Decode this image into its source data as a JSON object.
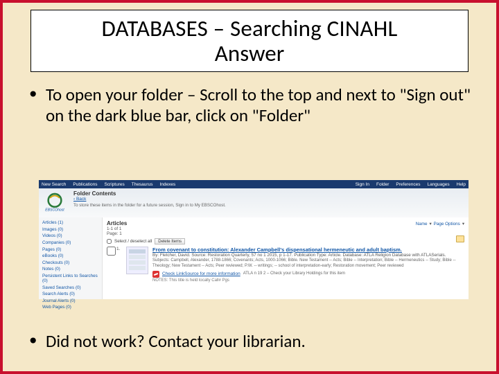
{
  "title_line1": "DATABASES – Searching CINAHL",
  "title_line2": "Answer",
  "bullet1": "To open your folder – Scroll to the top and next to \"Sign out\" on the dark blue bar, click on \"Folder\"",
  "bullet3": "Did not work?  Contact your librarian.",
  "ebsco": {
    "topbar": {
      "left": [
        "New Search",
        "Publications",
        "Scriptures",
        "Thesaurus",
        "Indexes"
      ],
      "right": [
        "Sign In",
        "Folder",
        "Preferences",
        "Languages",
        "Help"
      ]
    },
    "folder_contents": "Folder Contents",
    "back_link": "‹ Back",
    "save_note": "To store these items in the folder for a future session, Sign in to My EBSCOhost.",
    "sidebar": {
      "items": [
        "Articles (1)",
        "Images (0)",
        "Videos (0)",
        "Companies (0)",
        "Pages (0)",
        "eBooks (0)",
        "Checkouts (0)",
        "Notes (0)",
        "Persistent Links to Searches (0)",
        "Saved Searches (0)",
        "Search Alerts (0)",
        "Journal Alerts (0)",
        "Web Pages (0)"
      ]
    },
    "main": {
      "heading": "Articles",
      "range": "1-1 of 1",
      "page": "Page: 1",
      "name_sort": "Name",
      "page_options": "Page Options",
      "select_all": "Select / deselect all",
      "delete_btn": "Delete Items",
      "article": {
        "num": "1.",
        "title": "From covenant to constitution: Alexander Campbell's dispensational hermeneutic and adult baptism.",
        "by": "By: Fletcher, David. Source: Restoration Quarterly, 57 no 1 2015, p 1-17. Publication Type: Article. Database: ATLA Religion Database with ATLASerials.",
        "subjects": "Subjects: Campbell, Alexander, 1788-1866; Covenants; Acts, 1000-1066; Bible. New Testament -- Acts; Bible -- Interpretation; Bible -- Hermeneutics -- Study; Bible -- Theology; New Testament -- Acts; Peer reviewed; P.W. -- writings; -- school of interpretation-early; Restoration movement; Peer reviewed",
        "linksource": "Check LinkSource for more information",
        "holdings": "ATLA n 19 2 – Check your Library Holdings for this item",
        "notes": "NOTES: This title is held locally Call#   Pgs"
      }
    }
  }
}
